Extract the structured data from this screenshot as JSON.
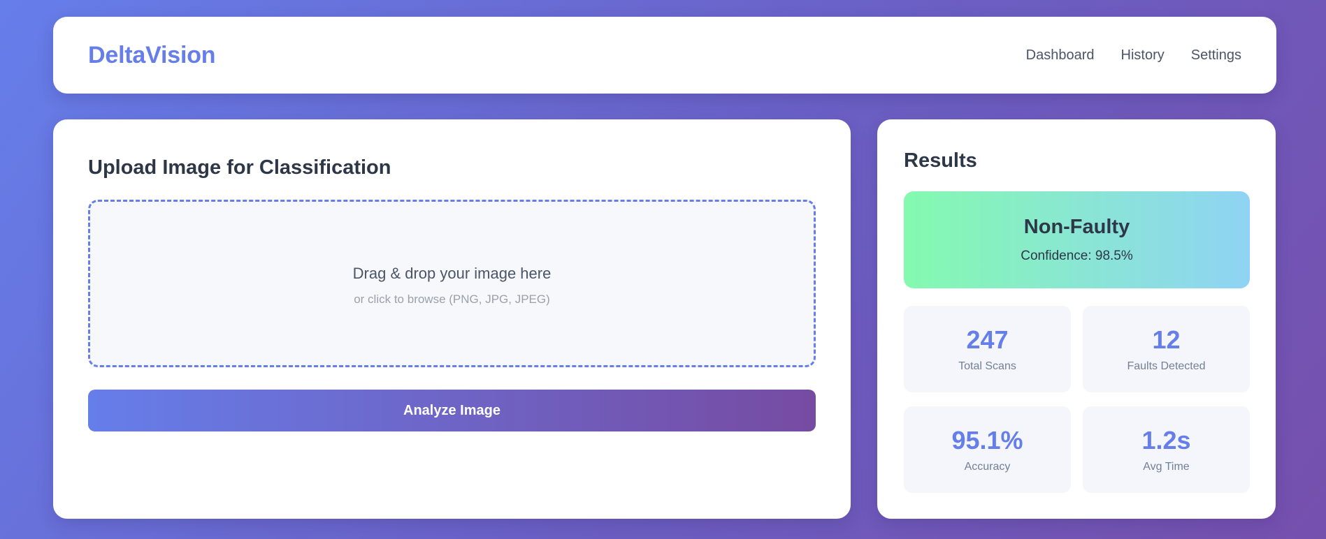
{
  "header": {
    "brand": "DeltaVision",
    "nav": [
      "Dashboard",
      "History",
      "Settings"
    ]
  },
  "upload": {
    "title": "Upload Image for Classification",
    "drop_main": "Drag & drop your image here",
    "drop_sub": "or click to browse (PNG, JPG, JPEG)",
    "analyze_label": "Analyze Image"
  },
  "results": {
    "title": "Results",
    "classification": "Non-Faulty",
    "confidence": "Confidence: 98.5%",
    "stats": [
      {
        "value": "247",
        "label": "Total Scans"
      },
      {
        "value": "12",
        "label": "Faults Detected"
      },
      {
        "value": "95.1%",
        "label": "Accuracy"
      },
      {
        "value": "1.2s",
        "label": "Avg Time"
      }
    ]
  },
  "colors": {
    "accent": "#667eea",
    "accent_end": "#764ba2",
    "success_start": "#84fab0",
    "success_end": "#8fd3f4"
  }
}
